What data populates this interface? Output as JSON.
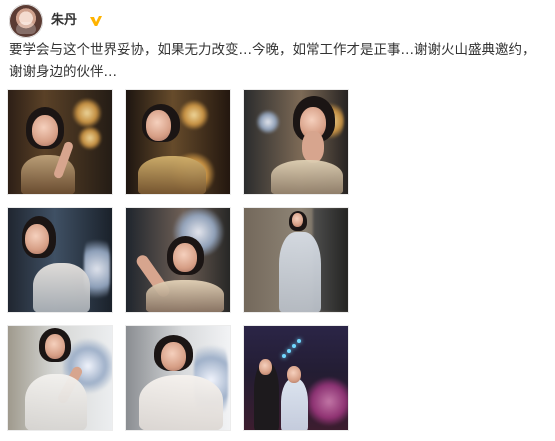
{
  "post": {
    "username": "朱丹",
    "verified_icon": "verified-v-icon",
    "text": "要学会与这个世界妥协，如果无力改变…今晚，如常工作才是正事…谢谢火山盛典邀约，谢谢身边的伙伴…"
  },
  "colors": {
    "verified": "#ffb300",
    "text": "#333333"
  },
  "gallery": {
    "photo_count": 9
  }
}
